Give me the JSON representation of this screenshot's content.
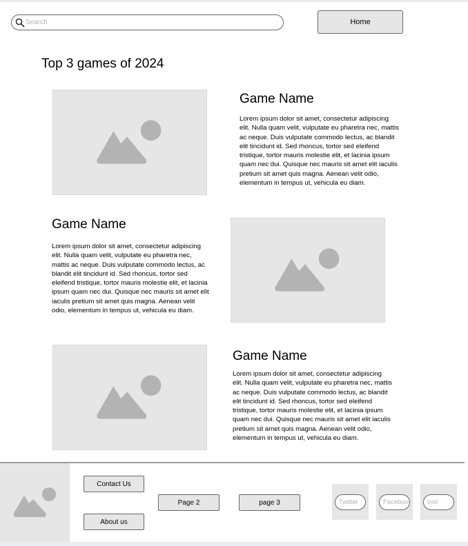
{
  "search": {
    "placeholder": "Search"
  },
  "header": {
    "home_label": "Home"
  },
  "heading": "Top 3 games of 2024",
  "games": [
    {
      "name": "Game Name",
      "body": "Lorem ipsum dolor sit amet, consectetur adipiscing elit. Nulla quam velit, vulputate eu pharetra nec, mattis ac neque. Duis vulputate commodo lectus, ac blandit elit tincidunt id. Sed rhoncus, tortor sed eleifend tristique, tortor mauris molestie elit, et lacinia ipsum quam nec dui. Quisque nec mauris sit amet elit iaculis pretium sit amet quis magna. Aenean velit odio, elementum in tempus ut, vehicula eu diam."
    },
    {
      "name": "Game Name",
      "body": "Lorem ipsum dolor sit amet, consectetur adipiscing elit. Nulla quam velit, vulputate eu pharetra nec, mattis ac neque. Duis vulputate commodo lectus, ac blandit elit tincidunt id. Sed rhoncus, tortor sed eleifend tristique, tortor mauris molestie elit, et lacinia ipsum quam nec dui. Quisque nec mauris sit amet elit iaculis pretium sit amet quis magna. Aenean velit odio, elementum in tempus ut, vehicula eu diam."
    },
    {
      "name": "Game Name",
      "body": "Lorem ipsum dolor sit amet, consectetur adipiscing elit. Nulla quam velit, vulputate eu pharetra nec, mattis ac neque. Duis vulputate commodo lectus, ac blandit elit tincidunt id. Sed rhoncus, tortor sed eleifend tristique, tortor mauris molestie elit, et lacinia ipsum quam nec dui. Quisque nec mauris sit amet elit iaculis pretium sit amet quis magna. Aenean velit odio, elementum in tempus ut, vehicula eu diam."
    }
  ],
  "footer": {
    "contact_label": "Contact Us",
    "about_label": "About us",
    "page2_label": "Page 2",
    "page3_label": "page 3",
    "social": [
      {
        "label": "Twitter",
        "icon": "twitter-icon"
      },
      {
        "label": "Facebook",
        "icon": "facebook-icon"
      },
      {
        "label": "Inst",
        "icon": "instagram-icon"
      }
    ]
  },
  "colors": {
    "placeholder_bg": "#e6e6e6",
    "placeholder_art": "#b3b3b3",
    "border": "#666666"
  }
}
